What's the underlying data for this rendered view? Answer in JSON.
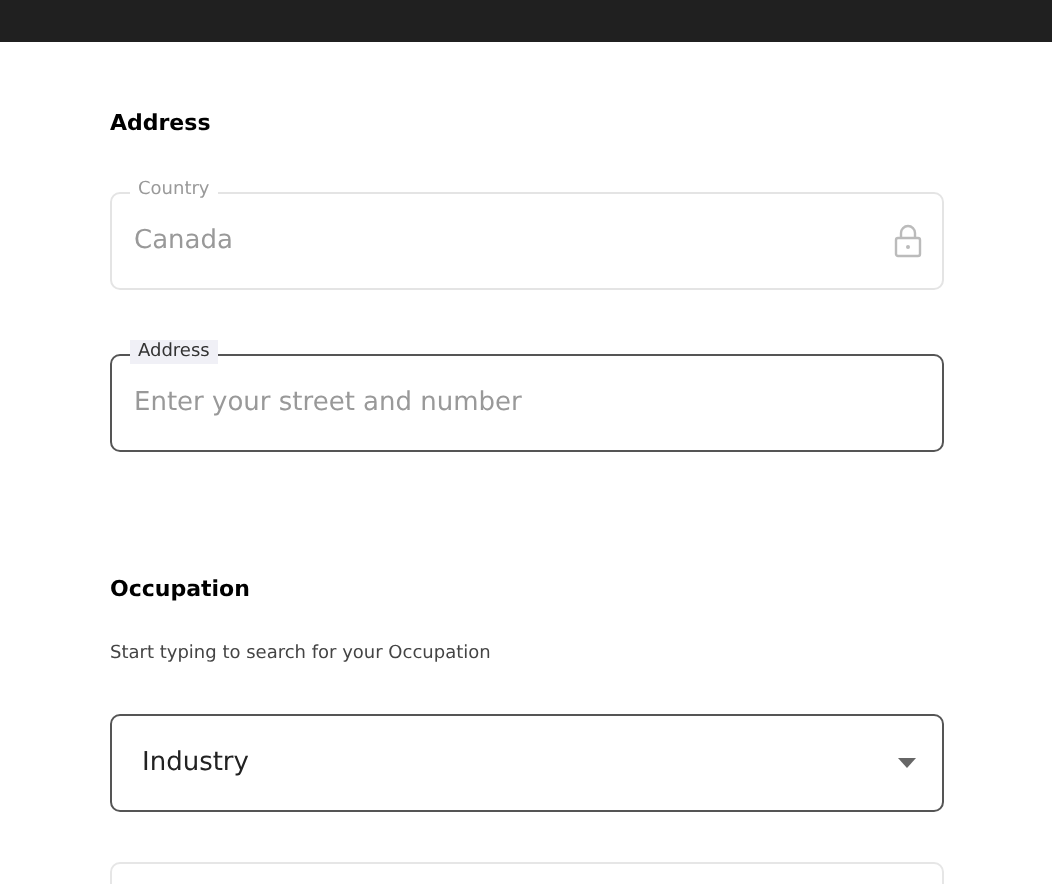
{
  "address_section": {
    "heading": "Address",
    "fields": [
      {
        "label": "Country",
        "value": "Canada",
        "disabled": true
      },
      {
        "label": "Address",
        "placeholder": "Enter your street and number",
        "disabled": false
      }
    ]
  },
  "occupation_section": {
    "heading": "Occupation",
    "hint": "Start typing to search for your Occupation",
    "select": {
      "value": "Industry"
    }
  }
}
